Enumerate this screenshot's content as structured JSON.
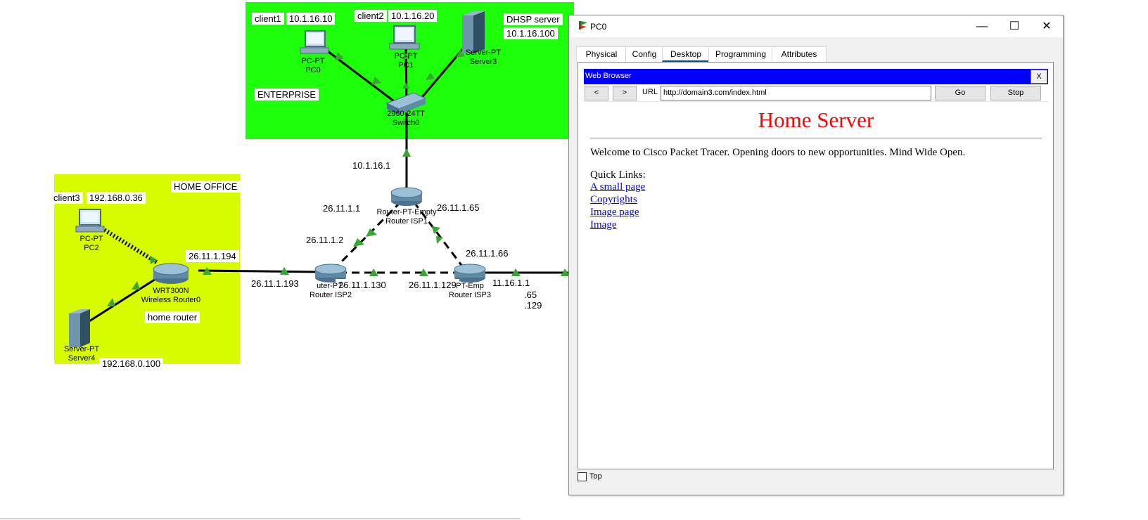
{
  "topology": {
    "zones": {
      "enterprise": "ENTERPRISE",
      "home_office": "HOME OFFICE",
      "home_router": "home router"
    },
    "labels": {
      "client1": "client1",
      "client1_ip": "10.1.16.10",
      "client2": "client2",
      "client2_ip": "10.1.16.20",
      "dhsp_server": "DHSP server",
      "dhsp_ip": "10.1.16.100",
      "client3": "client3",
      "client3_ip": "192.168.0.36",
      "server4_ip": "192.168.0.100",
      "gw_enterprise": "10.1.16.1",
      "isp1_left": "26.11.1.1",
      "isp1_right": "26.11.1.65",
      "isp2_up": "26.11.1.2",
      "home_wan": "26.11.1.194",
      "isp2_left": "26.11.1.193",
      "isp2_right": "26.11.1.130",
      "isp3_left": "26.11.1.129",
      "isp3_up": "26.11.1.66",
      "isp3_right": "11.16.1.1",
      "frag_65": ".65",
      "frag_129": ".129"
    },
    "devices": {
      "pc0_type": "PC-PT",
      "pc0_name": "PC0",
      "pc1_type": "PC-PT",
      "pc1_name": "PC1",
      "server3_type": "Server-PT",
      "server3_name": "Server3",
      "switch_type": "2960-24TT",
      "switch_name": "Switch0",
      "isp1_type": "Router-PT-Empty",
      "isp1_name": "Router ISP1",
      "isp2_type": "uter-PT-",
      "isp2_name": "Router ISP2",
      "isp3_type": "PT-Emp",
      "isp3_name": "Router ISP3",
      "pc2_type": "PC-PT",
      "pc2_name": "PC2",
      "wr_type": "WRT300N",
      "wr_name": "Wireless Router0",
      "server4_type": "Server-PT",
      "server4_name": "Server4"
    }
  },
  "window": {
    "title": "PC0",
    "minimize": "—",
    "maximize": "☐",
    "close": "✕",
    "tabs": [
      "Physical",
      "Config",
      "Desktop",
      "Programming",
      "Attributes"
    ],
    "active_tab": "Desktop",
    "browser": {
      "title": "Web Browser",
      "close": "X",
      "back": "<",
      "forward": ">",
      "url_label": "URL",
      "url": "http://domain3.com/index.html",
      "go": "Go",
      "stop": "Stop",
      "page": {
        "heading": "Home Server",
        "welcome": "Welcome to Cisco Packet Tracer. Opening doors to new opportunities. Mind Wide Open.",
        "quick_links_label": "Quick Links:",
        "links": [
          "A small page",
          "Copyrights",
          "Image page",
          "Image"
        ]
      }
    },
    "top_checkbox_label": "Top"
  },
  "colors": {
    "enterprise_zone": "#1dff0a",
    "home_zone": "#d7fc00",
    "browser_bar": "#0000ff",
    "heading": "#ff0000",
    "link": "#0000ee",
    "link_up_triangle": "#38a832"
  }
}
